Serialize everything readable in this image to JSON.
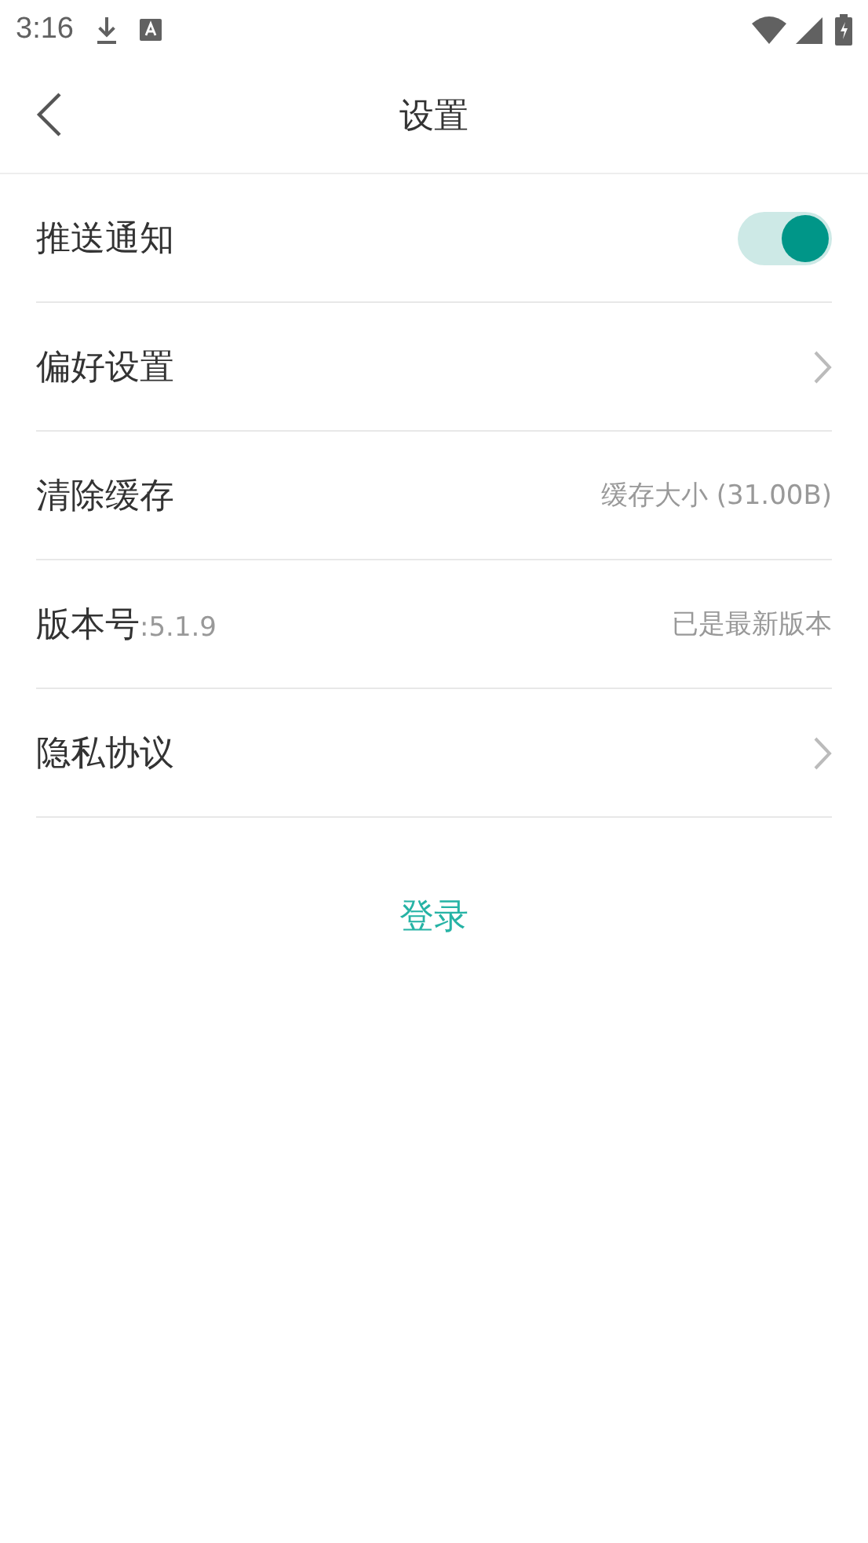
{
  "status_bar": {
    "time": "3:16"
  },
  "header": {
    "title": "设置"
  },
  "rows": [
    {
      "kind": "toggle",
      "label": "推送通知",
      "on": true
    },
    {
      "kind": "link",
      "label": "偏好设置"
    },
    {
      "kind": "value",
      "label": "清除缓存",
      "value": "缓存大小 (31.00B)"
    },
    {
      "kind": "version",
      "label": "版本号",
      "suffix": ":5.1.9",
      "value": "已是最新版本"
    },
    {
      "kind": "link",
      "label": "隐私协议"
    }
  ],
  "login": {
    "label": "登录"
  }
}
